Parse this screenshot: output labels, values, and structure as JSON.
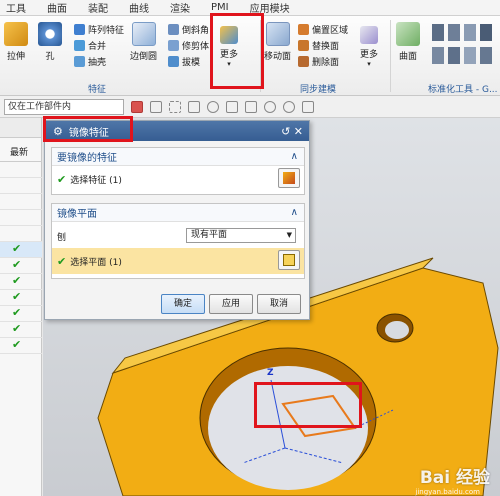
{
  "menu": [
    "工具",
    "曲面",
    "装配",
    "曲线",
    "渲染",
    "PMI",
    "应用模块"
  ],
  "ribbon": {
    "feature_group": {
      "label": "特征",
      "buttons": [
        {
          "label": "拉伸",
          "icon": "extrude-icon"
        },
        {
          "label": "孔",
          "icon": "hole-icon"
        },
        {
          "label": "边倒圆",
          "icon": "edge-blend-icon"
        },
        {
          "label": "更多",
          "icon": "more-icon"
        }
      ],
      "small_buttons": [
        {
          "label": "阵列特征",
          "icon": "pattern-feature-icon"
        },
        {
          "label": "合并",
          "icon": "unite-icon"
        },
        {
          "label": "抽壳",
          "icon": "shell-icon"
        },
        {
          "label": "倒斜角",
          "icon": "chamfer-icon"
        },
        {
          "label": "修剪体",
          "icon": "trim-body-icon"
        },
        {
          "label": "拔模",
          "icon": "draft-icon"
        }
      ]
    },
    "sync_group": {
      "label": "同步建模",
      "buttons": [
        {
          "label": "移动面",
          "icon": "move-face-icon"
        },
        {
          "label": "更多",
          "icon": "more-icon"
        }
      ],
      "small_buttons": [
        {
          "label": "偏置区域",
          "icon": "offset-region-icon"
        },
        {
          "label": "替换面",
          "icon": "replace-face-icon"
        },
        {
          "label": "删除面",
          "icon": "delete-face-icon"
        }
      ]
    },
    "surface_group": {
      "buttons": [
        {
          "label": "曲面",
          "icon": "surface-icon"
        }
      ]
    },
    "std_group": {
      "label": "标准化工具 - G..."
    }
  },
  "toolbar": {
    "filter_value": "仅在工作部件内"
  },
  "left_panel": {
    "header": "",
    "column": "最新",
    "checks": [
      "✔",
      "✔",
      "✔",
      "✔",
      "✔",
      "✔",
      "✔"
    ]
  },
  "dialog": {
    "title": "镜像特征",
    "title_tools": "↺ ✕",
    "feature_section": {
      "title": "要镜像的特征",
      "row": "选择特征 (1)"
    },
    "plane_section": {
      "title": "镜像平面",
      "plane_label": "刨",
      "plane_value": "现有平面",
      "row": "选择平面 (1)"
    },
    "buttons": {
      "ok": "确定",
      "apply": "应用",
      "cancel": "取消"
    }
  },
  "graphics": {
    "axis_label": "Z"
  },
  "watermark": {
    "text": "Bai 经验",
    "sub": "jingyan.baidu.com"
  },
  "colors": {
    "part": "#f2ad14",
    "title_bar": "#3f679b",
    "highlight_row": "#fbe4a2",
    "annotation": "#e0141c"
  }
}
